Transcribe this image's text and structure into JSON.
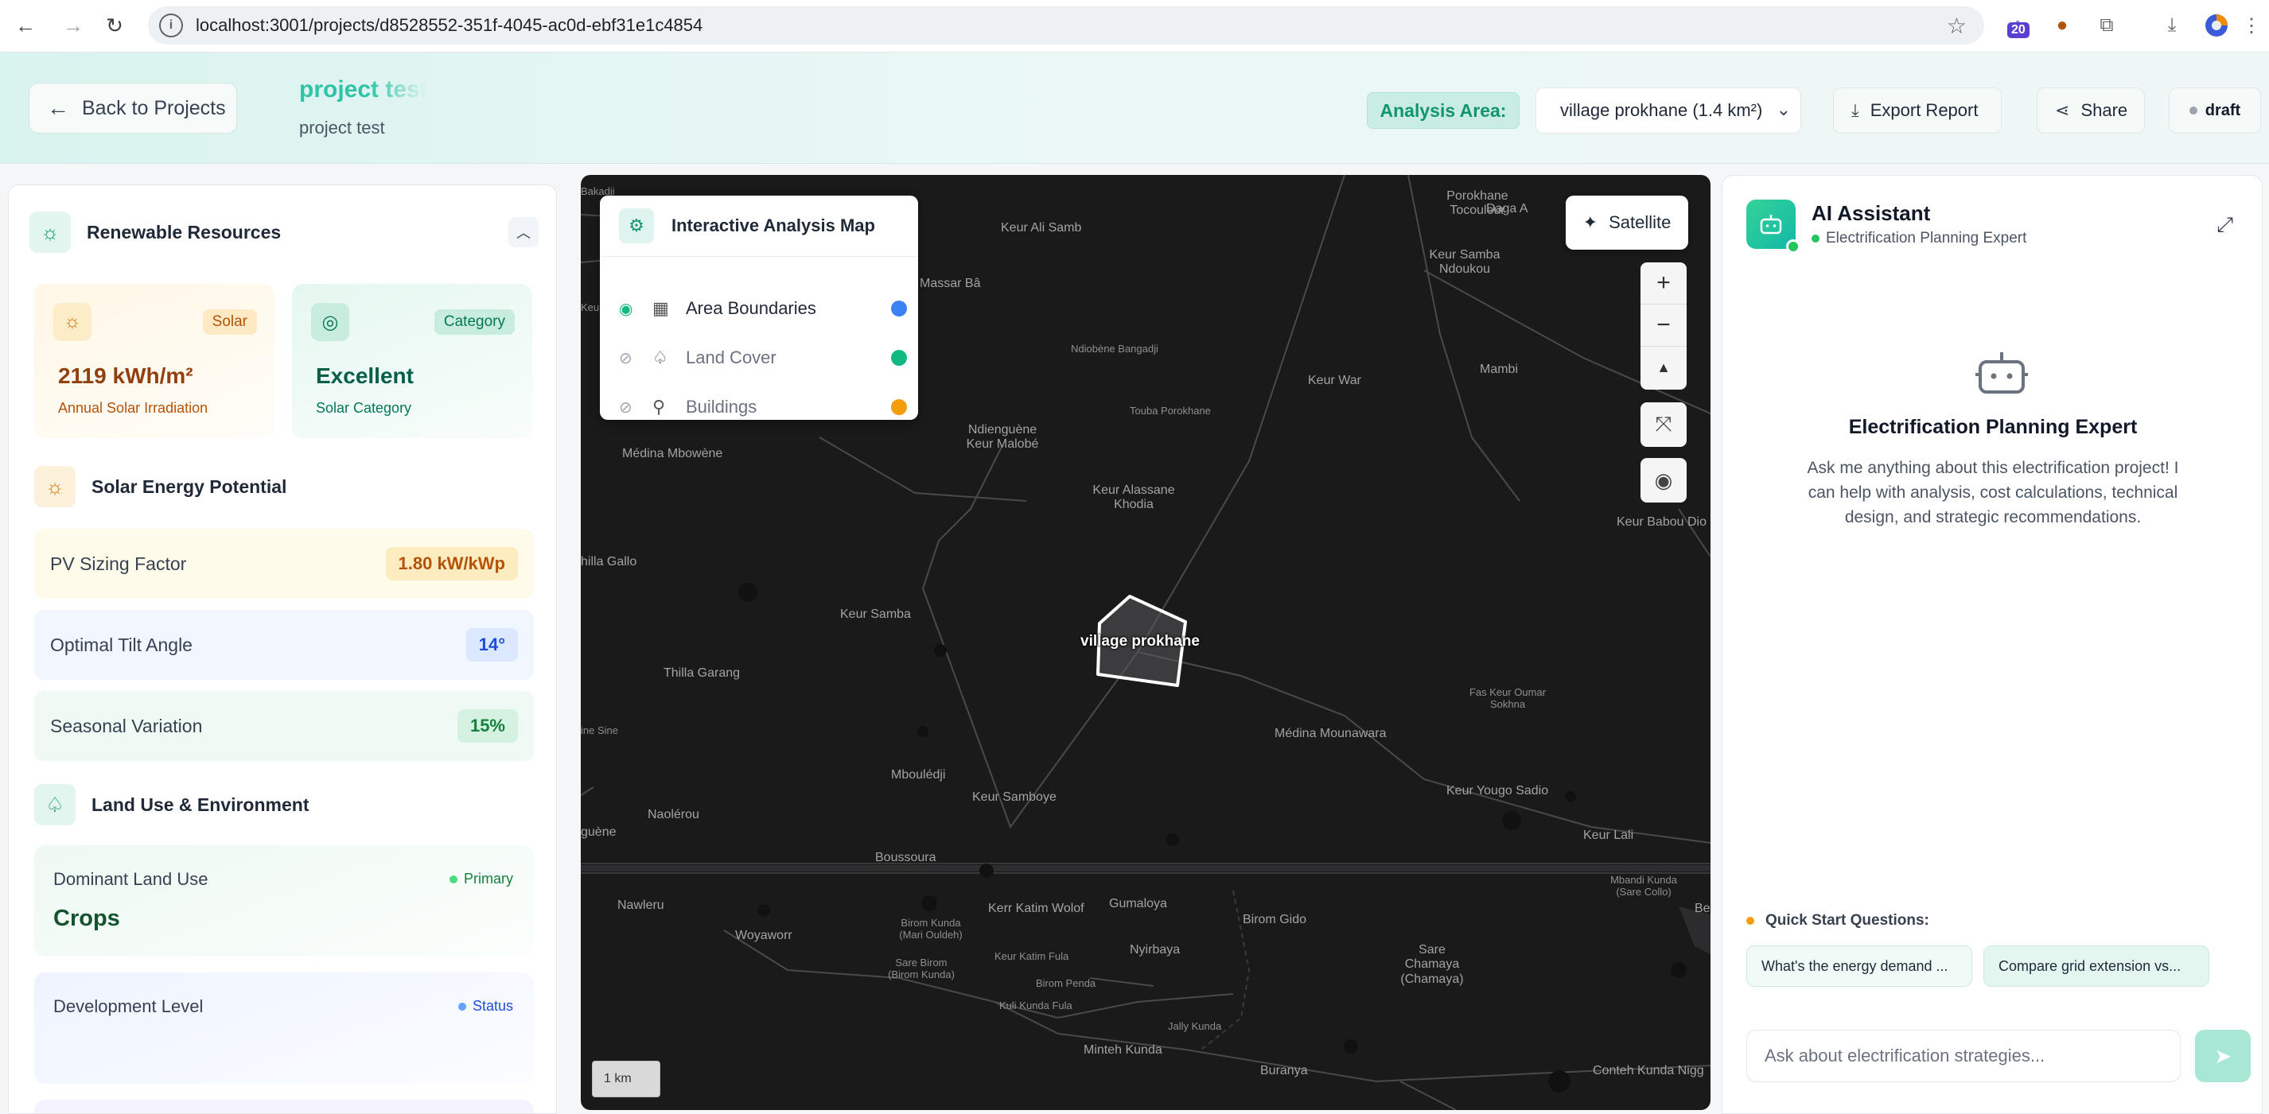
{
  "browser": {
    "url": "localhost:3001/projects/d8528552-351f-4045-ac0d-ebf31e1c4854",
    "extension_badge": "20"
  },
  "header": {
    "back_label": "Back to Projects",
    "project_title": "project test",
    "project_subtitle": "project test",
    "analysis_area_label": "Analysis Area:",
    "analysis_area_value": "village prokhane (1.4 km²)",
    "export_label": "Export Report",
    "share_label": "Share",
    "status_label": "draft"
  },
  "left_panel": {
    "renewable_title": "Renewable Resources",
    "solar_card": {
      "badge": "Solar",
      "value": "2119 kWh/m²",
      "caption": "Annual Solar Irradiation"
    },
    "category_card": {
      "badge": "Category",
      "value": "Excellent",
      "caption": "Solar Category"
    },
    "solar_potential_title": "Solar Energy Potential",
    "metrics": [
      {
        "label": "PV Sizing Factor",
        "value": "1.80 kW/kWp"
      },
      {
        "label": "Optimal Tilt Angle",
        "value": "14°"
      },
      {
        "label": "Seasonal Variation",
        "value": "15%"
      }
    ],
    "land_use_title": "Land Use & Environment",
    "dominant_land_use": {
      "label": "Dominant Land Use",
      "tag": "Primary",
      "value": "Crops"
    },
    "development_level": {
      "label": "Development Level",
      "tag": "Status"
    }
  },
  "map": {
    "layers_title": "Interactive Analysis Map",
    "layers": [
      {
        "name": "Area Boundaries",
        "visible": true,
        "color": "#3b82f6"
      },
      {
        "name": "Land Cover",
        "visible": false,
        "color": "#10b981"
      },
      {
        "name": "Buildings",
        "visible": false,
        "color": "#f59e0b"
      }
    ],
    "satellite_label": "Satellite",
    "scale_label": "1 km",
    "village_label": "village prokhane",
    "places": [
      "Keur Ali Samb",
      "Massar Bâ",
      "Porokhane Tocouleur",
      "Daga A",
      "Keur Samba Ndoukou",
      "Ndiobène Bangadji",
      "Keur War",
      "Mambi",
      "Touba Porokhane",
      "Ndienguène Keur Malobé",
      "Médina Mbowène",
      "Keur Alassane Khodia",
      "Keur Babou Dio",
      "hilla Gallo",
      "Keur Samba",
      "Thilla Garang",
      "Fas Keur Oumar Sokhna",
      "ine Sine",
      "Médina Mounawara",
      "Mboulédji",
      "Keur Samboye",
      "Keur Yougo Sadio",
      "Naolérou",
      "guène",
      "Keur Lali",
      "Boussoura",
      "Nawleru",
      "Mbandi Kunda (Sare Collo)",
      "Kerr Katim Wolof",
      "Gumaloya",
      "Birom Kunda (Mari Ouldeh)",
      "Woyaworr",
      "Birom Gido",
      "Nyirbaya",
      "Sare Chamaya (Chamaya)",
      "Keur Katim Fula",
      "Sare Birom (Birom Kunda)",
      "Birom Penda",
      "Kuli Kunda Fula",
      "Jally Kunda",
      "Minteh Kunda",
      "Buranya",
      "Conteh Kunda Nigg",
      "Bakadji",
      "Keur A",
      "Be"
    ]
  },
  "ai_panel": {
    "title": "AI Assistant",
    "subtitle": "Electrification Planning Expert",
    "expert_title": "Electrification Planning Expert",
    "expert_desc": "Ask me anything about this electrification project! I can help with analysis, cost calculations, technical design, and strategic recommendations.",
    "quick_start_label": "Quick Start Questions:",
    "quick_questions": [
      "What's the energy demand ...",
      "Compare grid extension vs..."
    ],
    "input_placeholder": "Ask about electrification strategies..."
  }
}
